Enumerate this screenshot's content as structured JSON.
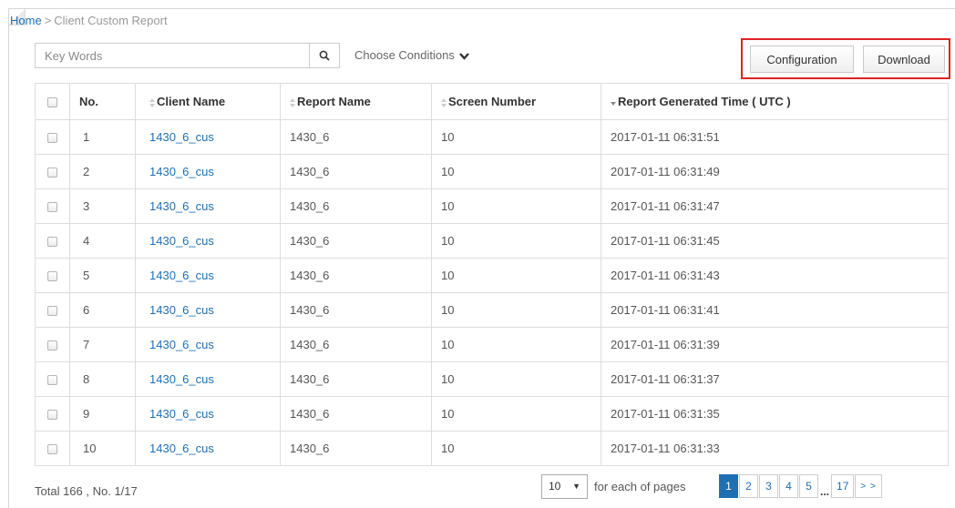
{
  "breadcrumb": {
    "home": "Home",
    "separator": ">",
    "current": "Client Custom Report"
  },
  "search": {
    "placeholder": "Key Words",
    "conditions_label": "Choose Conditions"
  },
  "toolbar": {
    "configuration_label": "Configuration",
    "download_label": "Download",
    "highlight_color": "#e02323"
  },
  "table": {
    "headers": [
      "No.",
      "Client Name",
      "Report Name",
      "Screen Number",
      "Report Generated Time ( UTC )"
    ],
    "rows": [
      {
        "no": "1",
        "client": "1430_6_cus",
        "report": "1430_6",
        "screen": "10",
        "time": "2017-01-11 06:31:51"
      },
      {
        "no": "2",
        "client": "1430_6_cus",
        "report": "1430_6",
        "screen": "10",
        "time": "2017-01-11 06:31:49"
      },
      {
        "no": "3",
        "client": "1430_6_cus",
        "report": "1430_6",
        "screen": "10",
        "time": "2017-01-11 06:31:47"
      },
      {
        "no": "4",
        "client": "1430_6_cus",
        "report": "1430_6",
        "screen": "10",
        "time": "2017-01-11 06:31:45"
      },
      {
        "no": "5",
        "client": "1430_6_cus",
        "report": "1430_6",
        "screen": "10",
        "time": "2017-01-11 06:31:43"
      },
      {
        "no": "6",
        "client": "1430_6_cus",
        "report": "1430_6",
        "screen": "10",
        "time": "2017-01-11 06:31:41"
      },
      {
        "no": "7",
        "client": "1430_6_cus",
        "report": "1430_6",
        "screen": "10",
        "time": "2017-01-11 06:31:39"
      },
      {
        "no": "8",
        "client": "1430_6_cus",
        "report": "1430_6",
        "screen": "10",
        "time": "2017-01-11 06:31:37"
      },
      {
        "no": "9",
        "client": "1430_6_cus",
        "report": "1430_6",
        "screen": "10",
        "time": "2017-01-11 06:31:35"
      },
      {
        "no": "10",
        "client": "1430_6_cus",
        "report": "1430_6",
        "screen": "10",
        "time": "2017-01-11 06:31:33"
      }
    ]
  },
  "footer": {
    "total": "Total 166 , No. 1/17",
    "page_size": "10",
    "page_size_label": "for each of pages",
    "pages": [
      "1",
      "2",
      "3",
      "4",
      "5"
    ],
    "ellipsis": "...",
    "last_page": "17",
    "next": "> >",
    "active_color": "#1f6fb2"
  }
}
